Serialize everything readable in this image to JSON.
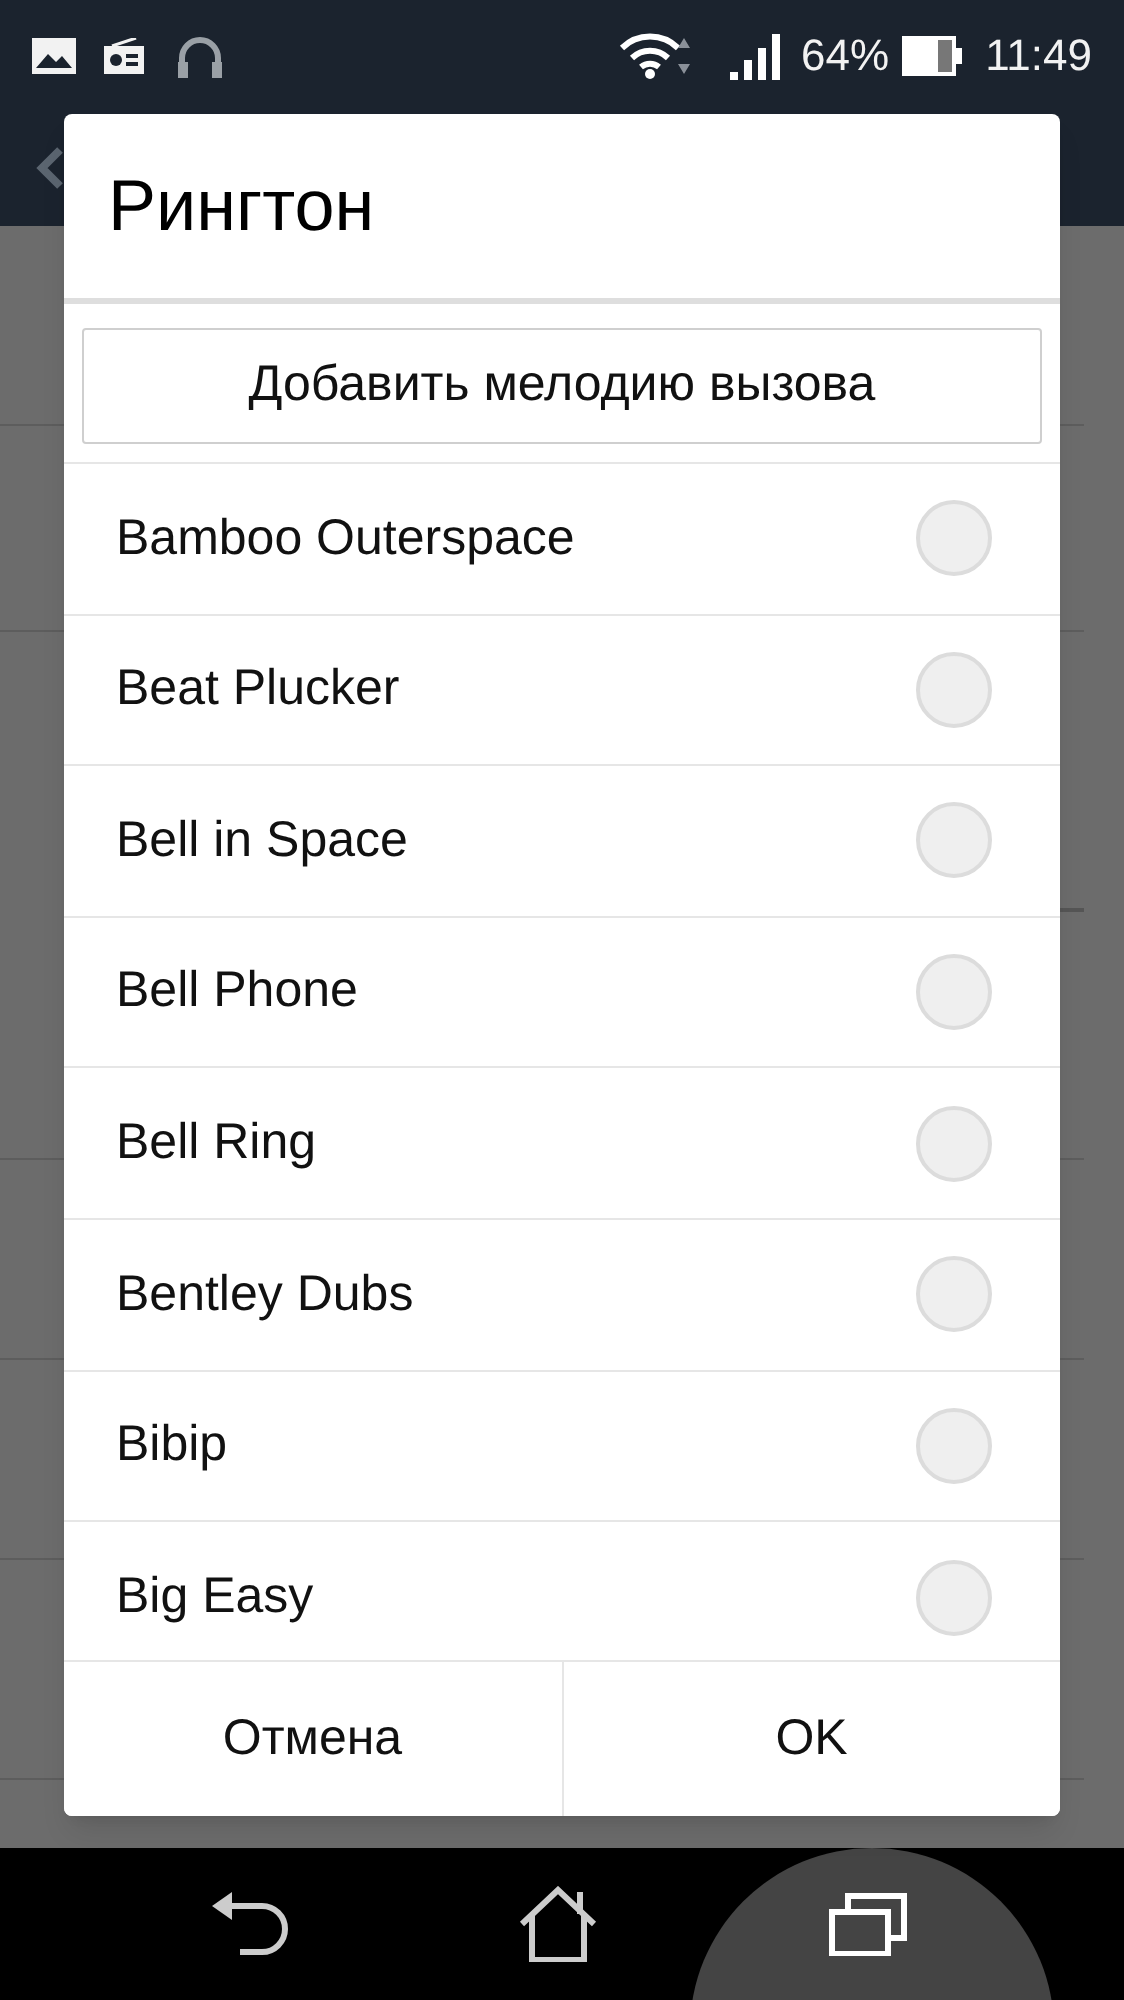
{
  "status_bar": {
    "battery": "64%",
    "time": "11:49"
  },
  "dialog": {
    "title": "Рингтон",
    "add_button": "Добавить мелодию вызова",
    "ringtones": [
      {
        "label": "Bamboo Outerspace",
        "selected": false
      },
      {
        "label": "Beat Plucker",
        "selected": false
      },
      {
        "label": "Bell in Space",
        "selected": false
      },
      {
        "label": "Bell Phone",
        "selected": false
      },
      {
        "label": "Bell Ring",
        "selected": false
      },
      {
        "label": "Bentley Dubs",
        "selected": false
      },
      {
        "label": "Bibip",
        "selected": false
      },
      {
        "label": "Big Easy",
        "selected": false
      }
    ],
    "buttons": [
      "Отмена",
      "OK"
    ]
  }
}
